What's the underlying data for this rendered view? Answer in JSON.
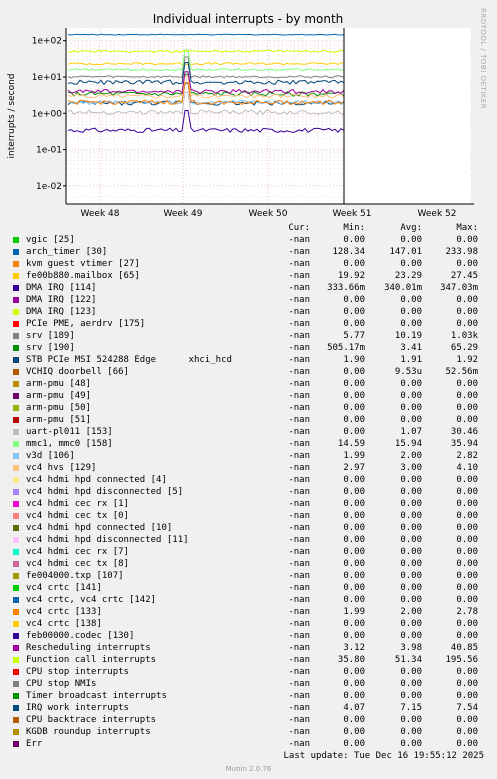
{
  "chart_data": {
    "type": "line",
    "title": "Individual interrupts - by month",
    "ylabel": "interrupts / second",
    "xlabel": "",
    "scale": "log",
    "ylim": [
      0.003,
      250
    ],
    "y_ticks": [
      "1e+02",
      "1e+01",
      "1e+00",
      "1e-01",
      "1e-02"
    ],
    "x_ticks": [
      "Week 48",
      "Week 49",
      "Week 50",
      "Week 51",
      "Week 52"
    ],
    "grid": true,
    "columns": [
      "Cur:",
      "Min:",
      "Avg:",
      "Max:"
    ],
    "series": [
      {
        "name": "vgic [25]",
        "color": "#00cc00",
        "cur": "-nan",
        "min": "0.00",
        "avg": "0.00",
        "max": "0.00",
        "level": 0
      },
      {
        "name": "arch_timer [30]",
        "color": "#0066b3",
        "cur": "-nan",
        "min": "128.34",
        "avg": "147.01",
        "max": "233.98",
        "level": 147.01
      },
      {
        "name": "kvm guest vtimer [27]",
        "color": "#ff8000",
        "cur": "-nan",
        "min": "0.00",
        "avg": "0.00",
        "max": "0.00",
        "level": 0
      },
      {
        "name": "fe00b880.mailbox [65]",
        "color": "#ffcc00",
        "cur": "-nan",
        "min": "19.92",
        "avg": "23.29",
        "max": "27.45",
        "level": 23.29
      },
      {
        "name": "DMA IRQ [114]",
        "color": "#330099",
        "cur": "-nan",
        "min": "333.66m",
        "avg": "340.01m",
        "max": "347.03m",
        "level": 0.34
      },
      {
        "name": "DMA IRQ [122]",
        "color": "#990099",
        "cur": "-nan",
        "min": "0.00",
        "avg": "0.00",
        "max": "0.00",
        "level": 0
      },
      {
        "name": "DMA IRQ [123]",
        "color": "#ccff00",
        "cur": "-nan",
        "min": "0.00",
        "avg": "0.00",
        "max": "0.00",
        "level": 0
      },
      {
        "name": "PCIe PME, aerdrv [175]",
        "color": "#ff0000",
        "cur": "-nan",
        "min": "0.00",
        "avg": "0.00",
        "max": "0.00",
        "level": 0
      },
      {
        "name": "srv [189]",
        "color": "#808080",
        "cur": "-nan",
        "min": "5.77",
        "avg": "10.19",
        "max": "1.03k",
        "level": 10.19
      },
      {
        "name": "srv [190]",
        "color": "#008f00",
        "cur": "-nan",
        "min": "505.17m",
        "avg": "3.41",
        "max": "65.29",
        "level": 3.41
      },
      {
        "name": "STB PCIe MSI 524288 Edge      xhci_hcd",
        "color": "#00487d",
        "cur": "-nan",
        "min": "1.90",
        "avg": "1.91",
        "max": "1.92",
        "level": 1.91
      },
      {
        "name": "VCHIQ doorbell [66]",
        "color": "#b35a00",
        "cur": "-nan",
        "min": "0.00",
        "avg": "9.53u",
        "max": "52.56m",
        "level": 0
      },
      {
        "name": "arm-pmu [48]",
        "color": "#b38f00",
        "cur": "-nan",
        "min": "0.00",
        "avg": "0.00",
        "max": "0.00",
        "level": 0
      },
      {
        "name": "arm-pmu [49]",
        "color": "#6b006b",
        "cur": "-nan",
        "min": "0.00",
        "avg": "0.00",
        "max": "0.00",
        "level": 0
      },
      {
        "name": "arm-pmu [50]",
        "color": "#8fb300",
        "cur": "-nan",
        "min": "0.00",
        "avg": "0.00",
        "max": "0.00",
        "level": 0
      },
      {
        "name": "arm-pmu [51]",
        "color": "#b30000",
        "cur": "-nan",
        "min": "0.00",
        "avg": "0.00",
        "max": "0.00",
        "level": 0
      },
      {
        "name": "uart-pl011 [153]",
        "color": "#bebebe",
        "cur": "-nan",
        "min": "0.00",
        "avg": "1.07",
        "max": "30.46",
        "level": 1.07
      },
      {
        "name": "mmc1, mmc0 [158]",
        "color": "#80ff80",
        "cur": "-nan",
        "min": "14.59",
        "avg": "15.94",
        "max": "35.94",
        "level": 15.94
      },
      {
        "name": "v3d [106]",
        "color": "#80c9ff",
        "cur": "-nan",
        "min": "1.99",
        "avg": "2.00",
        "max": "2.82",
        "level": 2.0
      },
      {
        "name": "vc4 hvs [129]",
        "color": "#ffc080",
        "cur": "-nan",
        "min": "2.97",
        "avg": "3.00",
        "max": "4.10",
        "level": 3.0
      },
      {
        "name": "vc4 hdmi hpd connected [4]",
        "color": "#ffe680",
        "cur": "-nan",
        "min": "0.00",
        "avg": "0.00",
        "max": "0.00",
        "level": 0
      },
      {
        "name": "vc4 hdmi hpd disconnected [5]",
        "color": "#aa80ff",
        "cur": "-nan",
        "min": "0.00",
        "avg": "0.00",
        "max": "0.00",
        "level": 0
      },
      {
        "name": "vc4 hdmi cec rx [1]",
        "color": "#ee00cc",
        "cur": "-nan",
        "min": "0.00",
        "avg": "0.00",
        "max": "0.00",
        "level": 0
      },
      {
        "name": "vc4 hdmi cec tx [0]",
        "color": "#ff8080",
        "cur": "-nan",
        "min": "0.00",
        "avg": "0.00",
        "max": "0.00",
        "level": 0
      },
      {
        "name": "vc4 hdmi hpd connected [10]",
        "color": "#666600",
        "cur": "-nan",
        "min": "0.00",
        "avg": "0.00",
        "max": "0.00",
        "level": 0
      },
      {
        "name": "vc4 hdmi hpd disconnected [11]",
        "color": "#ffbfff",
        "cur": "-nan",
        "min": "0.00",
        "avg": "0.00",
        "max": "0.00",
        "level": 0
      },
      {
        "name": "vc4 hdmi cec rx [7]",
        "color": "#00ffcc",
        "cur": "-nan",
        "min": "0.00",
        "avg": "0.00",
        "max": "0.00",
        "level": 0
      },
      {
        "name": "vc4 hdmi cec tx [8]",
        "color": "#cc6699",
        "cur": "-nan",
        "min": "0.00",
        "avg": "0.00",
        "max": "0.00",
        "level": 0
      },
      {
        "name": "fe004000.txp [107]",
        "color": "#999900",
        "cur": "-nan",
        "min": "0.00",
        "avg": "0.00",
        "max": "0.00",
        "level": 0
      },
      {
        "name": "vc4 crtc [141]",
        "color": "#00cc00",
        "cur": "-nan",
        "min": "0.00",
        "avg": "0.00",
        "max": "0.00",
        "level": 0
      },
      {
        "name": "vc4 crtc, vc4 crtc [142]",
        "color": "#0066b3",
        "cur": "-nan",
        "min": "0.00",
        "avg": "0.00",
        "max": "0.00",
        "level": 0
      },
      {
        "name": "vc4 crtc [133]",
        "color": "#ff8000",
        "cur": "-nan",
        "min": "1.99",
        "avg": "2.00",
        "max": "2.78",
        "level": 2.0
      },
      {
        "name": "vc4 crtc [138]",
        "color": "#ffcc00",
        "cur": "-nan",
        "min": "0.00",
        "avg": "0.00",
        "max": "0.00",
        "level": 0
      },
      {
        "name": "feb00000.codec [130]",
        "color": "#330099",
        "cur": "-nan",
        "min": "0.00",
        "avg": "0.00",
        "max": "0.00",
        "level": 0
      },
      {
        "name": "Rescheduling interrupts",
        "color": "#990099",
        "cur": "-nan",
        "min": "3.12",
        "avg": "3.98",
        "max": "40.85",
        "level": 3.98
      },
      {
        "name": "Function call interrupts",
        "color": "#ccff00",
        "cur": "-nan",
        "min": "35.80",
        "avg": "51.34",
        "max": "195.56",
        "level": 51.34
      },
      {
        "name": "CPU stop interrupts",
        "color": "#ff0000",
        "cur": "-nan",
        "min": "0.00",
        "avg": "0.00",
        "max": "0.00",
        "level": 0
      },
      {
        "name": "CPU stop NMIs",
        "color": "#808080",
        "cur": "-nan",
        "min": "0.00",
        "avg": "0.00",
        "max": "0.00",
        "level": 0
      },
      {
        "name": "Timer broadcast interrupts",
        "color": "#008f00",
        "cur": "-nan",
        "min": "0.00",
        "avg": "0.00",
        "max": "0.00",
        "level": 0
      },
      {
        "name": "IRQ work interrupts",
        "color": "#00487d",
        "cur": "-nan",
        "min": "4.07",
        "avg": "7.15",
        "max": "7.54",
        "level": 7.15
      },
      {
        "name": "CPU backtrace interrupts",
        "color": "#b35a00",
        "cur": "-nan",
        "min": "0.00",
        "avg": "0.00",
        "max": "0.00",
        "level": 0
      },
      {
        "name": "KGDB roundup interrupts",
        "color": "#b38f00",
        "cur": "-nan",
        "min": "0.00",
        "avg": "0.00",
        "max": "0.00",
        "level": 0
      },
      {
        "name": "Err",
        "color": "#6b006b",
        "cur": "-nan",
        "min": "0.00",
        "avg": "0.00",
        "max": "0.00",
        "level": 0
      }
    ]
  },
  "footer": {
    "last_update": "Last update: Tue Dec 16 19:55:12 2025",
    "munin": "Munin 2.0.76",
    "rrdtool": "RRDTOOL / TOBI OETIKER"
  }
}
